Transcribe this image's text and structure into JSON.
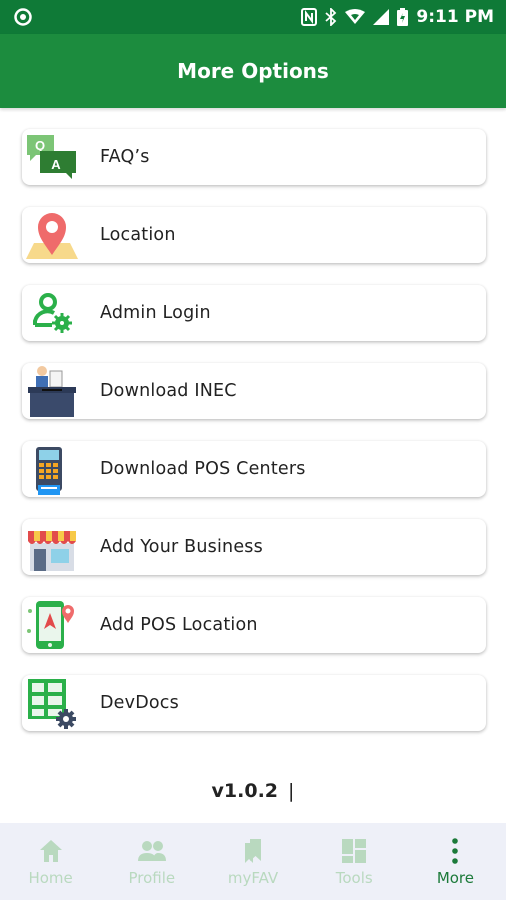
{
  "status_bar": {
    "time": "9:11 PM"
  },
  "header": {
    "title": "More Options"
  },
  "menu": {
    "items": [
      {
        "label": "FAQ’s",
        "icon": "faq-chat-icon"
      },
      {
        "label": "Location",
        "icon": "map-pin-icon"
      },
      {
        "label": "Admin Login",
        "icon": "admin-user-gear-icon"
      },
      {
        "label": "Download INEC",
        "icon": "ballot-box-icon"
      },
      {
        "label": "Download POS Centers",
        "icon": "pos-terminal-icon"
      },
      {
        "label": "Add Your Business",
        "icon": "storefront-icon"
      },
      {
        "label": "Add POS Location",
        "icon": "phone-location-icon"
      },
      {
        "label": "DevDocs",
        "icon": "grid-gear-icon"
      }
    ]
  },
  "footer": {
    "version": "v1.0.2",
    "caret": "|"
  },
  "bottom_nav": {
    "items": [
      {
        "label": "Home",
        "icon": "home-icon"
      },
      {
        "label": "Profile",
        "icon": "people-icon"
      },
      {
        "label": "myFAV",
        "icon": "bookmarks-icon"
      },
      {
        "label": "Tools",
        "icon": "tools-grid-icon"
      },
      {
        "label": "More",
        "icon": "more-vertical-icon"
      }
    ],
    "active_index": 4
  },
  "colors": {
    "status_bar": "#0f7a37",
    "app_bar": "#1c8c3e",
    "nav_inactive": "#b9d9bf",
    "nav_active": "#1c7a3a"
  }
}
